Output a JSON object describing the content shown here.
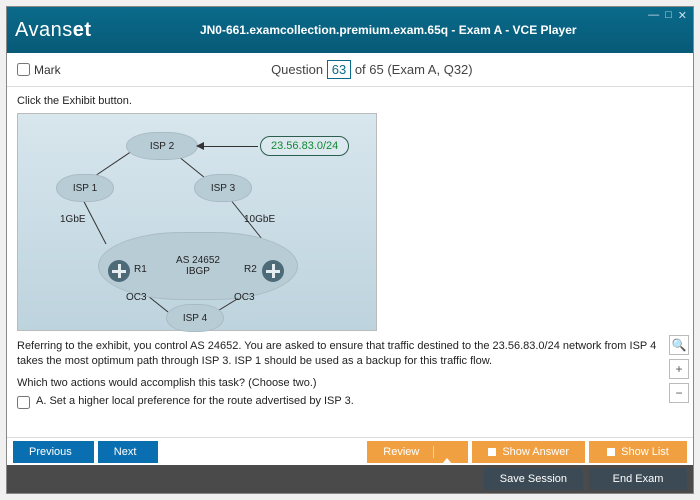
{
  "title": "JN0-661.examcollection.premium.exam.65q - Exam A - VCE Player",
  "logo_a": "Avans",
  "logo_b": "et",
  "wincontrols": {
    "min": "—",
    "max": "□",
    "close": "✕"
  },
  "mark_label": "Mark",
  "question_label": "Question",
  "question_number": "63",
  "question_total": " of 65 (Exam A, Q32)",
  "instruction": "Click the Exhibit button.",
  "exhibit": {
    "isp1": "ISP 1",
    "isp2": "ISP 2",
    "isp3": "ISP 3",
    "isp4": "ISP 4",
    "gbe1": "1GbE",
    "gbe10": "10GbE",
    "asnum": "AS 24652",
    "ibgp": "IBGP",
    "r1": "R1",
    "r2": "R2",
    "oc3a": "OC3",
    "oc3b": "OC3",
    "network": "23.56.83.0/24"
  },
  "qtext": "Referring to the exhibit, you control AS 24652. You are asked to ensure that traffic destined to the 23.56.83.0/24 network from ISP 4 takes the most optimum path through ISP 3. ISP 1 should be used as a backup for this traffic flow.",
  "choose": "Which two actions would accomplish this task? (Choose two.)",
  "optA": "A.   Set a higher local preference for the route advertised by ISP 3.",
  "footer": {
    "prev": "Previous",
    "next": "Next",
    "review": "Review",
    "show_answer": "Show Answer",
    "show_list": "Show List",
    "save": "Save Session",
    "end": "End Exam"
  },
  "tools": {
    "search": "🔍",
    "plus": "+",
    "minus": "−"
  }
}
